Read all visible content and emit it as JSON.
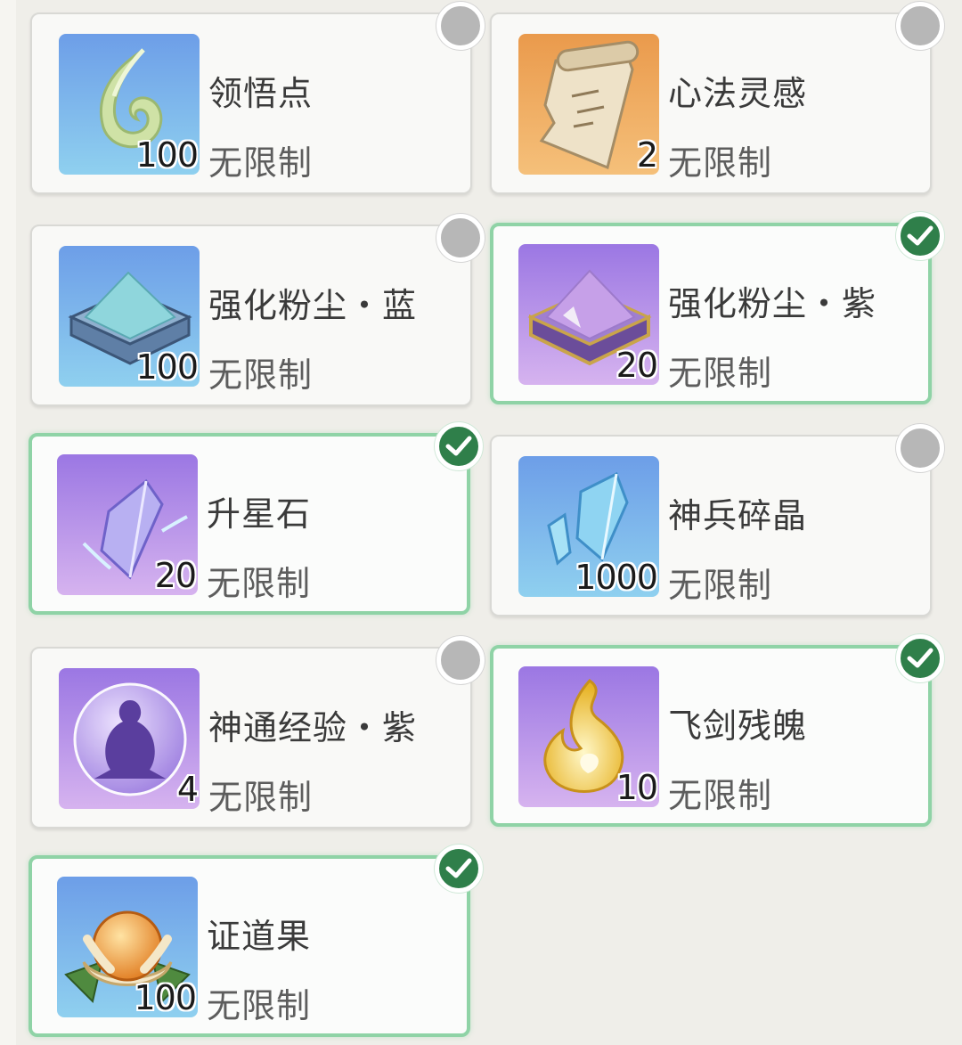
{
  "items": [
    {
      "name": "领悟点",
      "quantity": "100",
      "limit": "无限制",
      "selected": false,
      "icon": "leaf-swirl-icon",
      "bg": "blue"
    },
    {
      "name": "心法灵感",
      "quantity": "2",
      "limit": "无限制",
      "selected": false,
      "icon": "scroll-icon",
      "bg": "orange"
    },
    {
      "name": "强化粉尘・蓝",
      "quantity": "100",
      "limit": "无限制",
      "selected": false,
      "icon": "blue-dust-box-icon",
      "bg": "blue"
    },
    {
      "name": "强化粉尘・紫",
      "quantity": "20",
      "limit": "无限制",
      "selected": true,
      "icon": "purple-dust-box-icon",
      "bg": "purple"
    },
    {
      "name": "升星石",
      "quantity": "20",
      "limit": "无限制",
      "selected": true,
      "icon": "star-crystal-icon",
      "bg": "purple"
    },
    {
      "name": "神兵碎晶",
      "quantity": "1000",
      "limit": "无限制",
      "selected": false,
      "icon": "blue-crystal-shards-icon",
      "bg": "blue"
    },
    {
      "name": "神通经验・紫",
      "quantity": "4",
      "limit": "无限制",
      "selected": false,
      "icon": "spirit-orb-icon",
      "bg": "purple"
    },
    {
      "name": "飞剑残魄",
      "quantity": "10",
      "limit": "无限制",
      "selected": true,
      "icon": "golden-flame-icon",
      "bg": "purple"
    },
    {
      "name": "证道果",
      "quantity": "100",
      "limit": "无限制",
      "selected": true,
      "icon": "lotus-fruit-icon",
      "bg": "blue"
    }
  ],
  "colors": {
    "selected_border": "#8fd3a6",
    "check_fill": "#2f7f4a",
    "radio_off": "#b7b7b7",
    "bg_blue_top": "#6d9ee8",
    "bg_blue_bottom": "#8fd0ef",
    "bg_purple_top": "#9b77e3",
    "bg_purple_bottom": "#d6b3ef",
    "bg_orange_top": "#ea9a4c",
    "bg_orange_bottom": "#f5c07a"
  }
}
